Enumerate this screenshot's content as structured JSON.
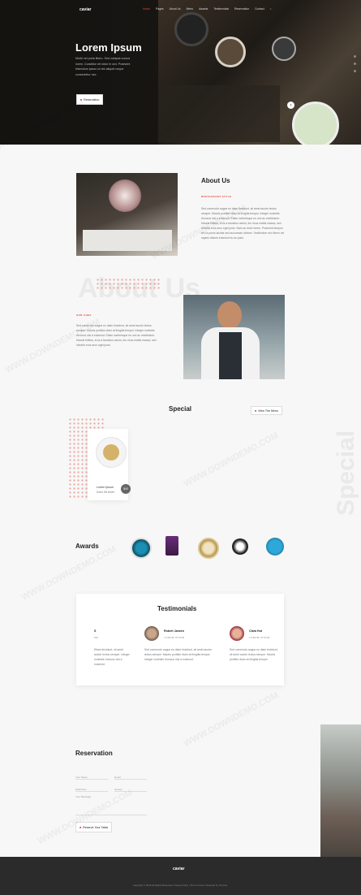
{
  "nav": {
    "logo": "caviar",
    "items": [
      "Home",
      "Pages",
      "About Us",
      "Menu",
      "Awards",
      "Testimonials",
      "Reservation",
      "Contact"
    ]
  },
  "hero": {
    "title": "Lorem Ipsum",
    "text": "Morbi vel porta libero. Sed volutpat cursus lorem. Curabitur vel dolor in orci. Praesent bibendum ipsum ut nisi aliquet neque consectetur nec.",
    "button": "Reservation"
  },
  "about": {
    "title": "About Us",
    "subtitle": "RESTAURANT STYLE",
    "text": "Sed commodo augue eu diam tincidunt, sit amet auctor lectus semper. Mauris porttitor diam at fringilla tempor. Integer molestie rhoncus nisi a euismod. Etiam scelerisque eu orci ac vestibulum. Mauris finibus, eros a faucibus varius, leo risus mattis massa, sed lobortis eros arcu eget justo. Nam ac dolor lorem. Praesent tempus leo ut purus lacinia sed accumsan ultrices. Vestibulum nec libero vel sapien dictum euismod eu ac justo."
  },
  "about_bg_text": "About Us",
  "chef": {
    "label": "OUR CHEF",
    "text": "Sed commodo augue eu diam tincidunt, sit amet auctor lectus semper. Mauris porttitor diam at fringilla tempor. Integer molestie rhoncus nisi a euismod. Etiam scelerisque eu orci ac vestibulum. Mauris finibus, eros a faucibus varius, leo risus mattis massa, sed lobortis eros arcu eget justo."
  },
  "special": {
    "title": "Special",
    "view_menu": "View The Menu",
    "bg_text": "Special",
    "dish_name": "Lorem Ipsum",
    "dish_sub": "Dolor Sit Amet",
    "price": "$40"
  },
  "awards": {
    "title": "Awards"
  },
  "testimonials": {
    "title": "Testimonials",
    "items": [
      {
        "name": "S",
        "role": "ME",
        "text": "Etiam tincidunt, sit amet auctor lectus semper. Integer molestie rhoncus nisi a euismod."
      },
      {
        "name": "Robert Jansen",
        "role": "LOREM IPSUM",
        "text": "Sed commodo augue eu diam tincidunt, sit amet auctor lectus semper. Mauris porttitor diam at fringilla tempor. Integer molestie rhoncus nisi a euismod."
      },
      {
        "name": "Clara Hut",
        "role": "LOREM IPSUM",
        "text": "Sed commodo augue eu diam tincidunt, sit amet auctor lectus semper. Mauris porttitor diam at fringilla tempor."
      }
    ]
  },
  "reservation": {
    "title": "Reservation",
    "fields": [
      "Your Name",
      "Email",
      "Date/Time",
      "Guests",
      "Your Message"
    ],
    "button": "Reserve Your Table"
  },
  "footer": {
    "logo": "caviar",
    "copyright": "Copyright © 2019 All Rights Reserved. Privacy Policy | Terms of Use | Powered by Themes"
  },
  "watermark": "WWW.DOWNDEMO.COM",
  "colors": {
    "accent": "#e0463a",
    "dark": "#2b2b2b"
  }
}
